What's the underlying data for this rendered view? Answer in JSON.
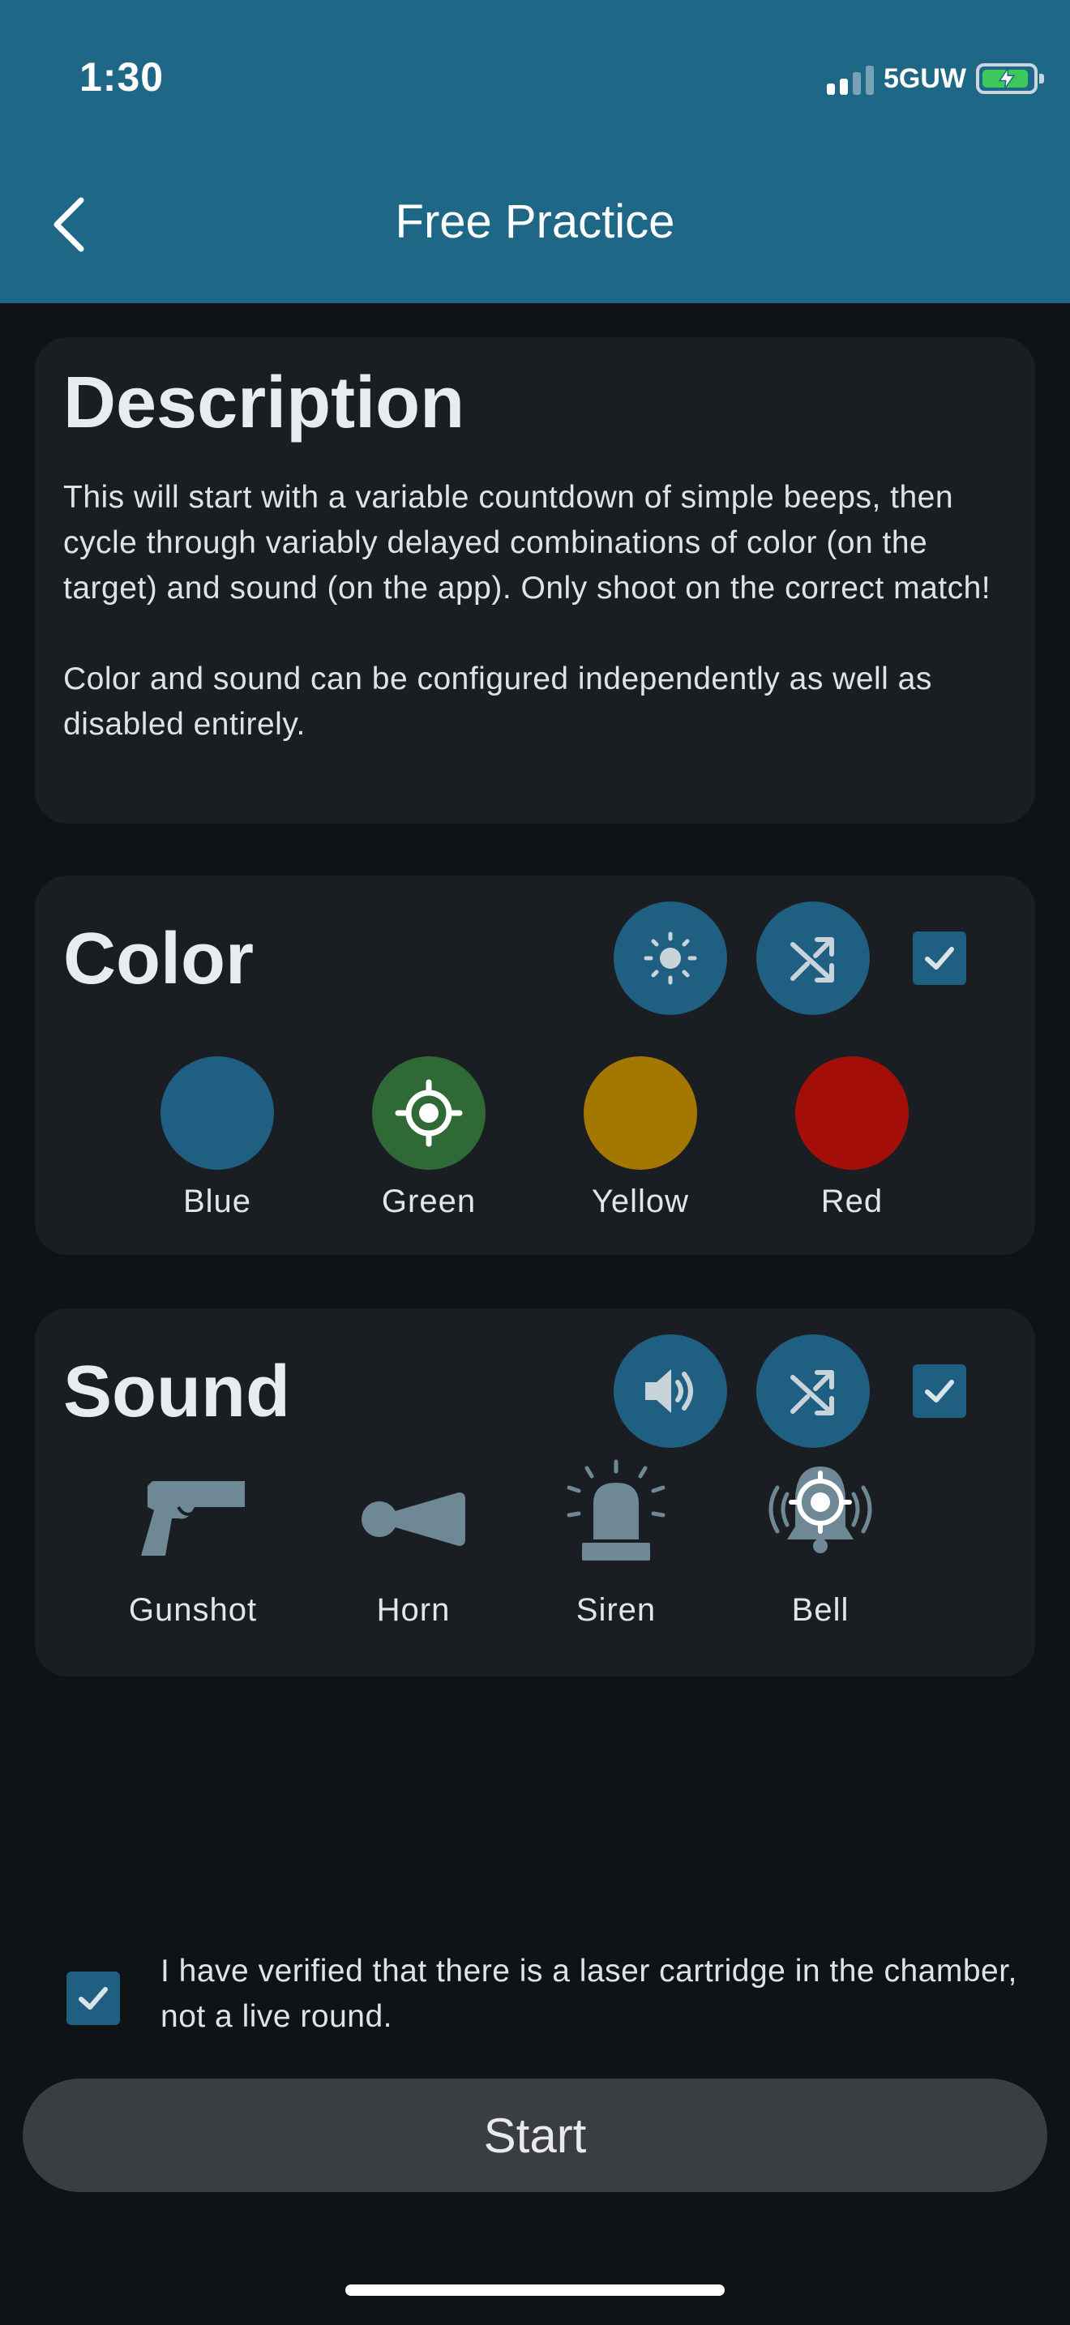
{
  "status": {
    "time": "1:30",
    "network": "5GUW"
  },
  "nav": {
    "title": "Free Practice"
  },
  "description": {
    "title": "Description",
    "paragraphs": [
      "This will start with a variable countdown of simple beeps, then cycle through variably delayed combinations of color (on the target) and sound (on the app). Only shoot on the correct match!",
      "Color and sound can be configured independently as well as disabled entirely."
    ]
  },
  "color": {
    "title": "Color",
    "enabled": true,
    "options": [
      {
        "label": "Blue",
        "color": "#1f5f82",
        "selected": false
      },
      {
        "label": "Green",
        "color": "#2f6a36",
        "selected": true
      },
      {
        "label": "Yellow",
        "color": "#a47800",
        "selected": false
      },
      {
        "label": "Red",
        "color": "#a30f08",
        "selected": false
      }
    ]
  },
  "sound": {
    "title": "Sound",
    "enabled": true,
    "options": [
      {
        "label": "Gunshot",
        "icon": "pistol-icon",
        "selected": false
      },
      {
        "label": "Horn",
        "icon": "horn-icon",
        "selected": false
      },
      {
        "label": "Siren",
        "icon": "siren-icon",
        "selected": false
      },
      {
        "label": "Bell",
        "icon": "bell-icon",
        "selected": true
      }
    ]
  },
  "verify": {
    "checked": true,
    "text": "I have verified that there is a laser cartridge in the chamber, not a live round."
  },
  "start_label": "Start",
  "colors": {
    "header": "#1f6787",
    "background": "#0f1316",
    "card": "#1a1e22",
    "accent": "#1f5f82",
    "icon_muted": "#6f8895"
  }
}
